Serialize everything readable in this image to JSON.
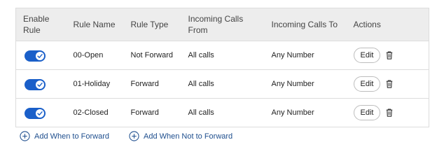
{
  "table": {
    "headers": {
      "enable_rule": "Enable Rule",
      "rule_name": "Rule Name",
      "rule_type": "Rule Type",
      "incoming_calls_from": "Incoming Calls From",
      "incoming_calls_to": "Incoming Calls To",
      "actions": "Actions"
    },
    "rows": [
      {
        "enabled": true,
        "name": "00-Open",
        "type": "Not Forward",
        "from": "All calls",
        "to": "Any Number",
        "edit_label": "Edit"
      },
      {
        "enabled": true,
        "name": "01-Holiday",
        "type": "Forward",
        "from": "All calls",
        "to": "Any Number",
        "edit_label": "Edit"
      },
      {
        "enabled": true,
        "name": "02-Closed",
        "type": "Forward",
        "from": "All calls",
        "to": "Any Number",
        "edit_label": "Edit"
      }
    ]
  },
  "links": {
    "add_when_forward": "Add When to Forward",
    "add_when_not_forward": "Add When Not to Forward"
  },
  "colors": {
    "toggle_on": "#1a5fc9",
    "link": "#1f4f8e",
    "header_bg": "#ededed"
  },
  "icons": {
    "toggle_check": "check-icon",
    "delete": "trash-icon",
    "add": "plus-circle-icon"
  }
}
